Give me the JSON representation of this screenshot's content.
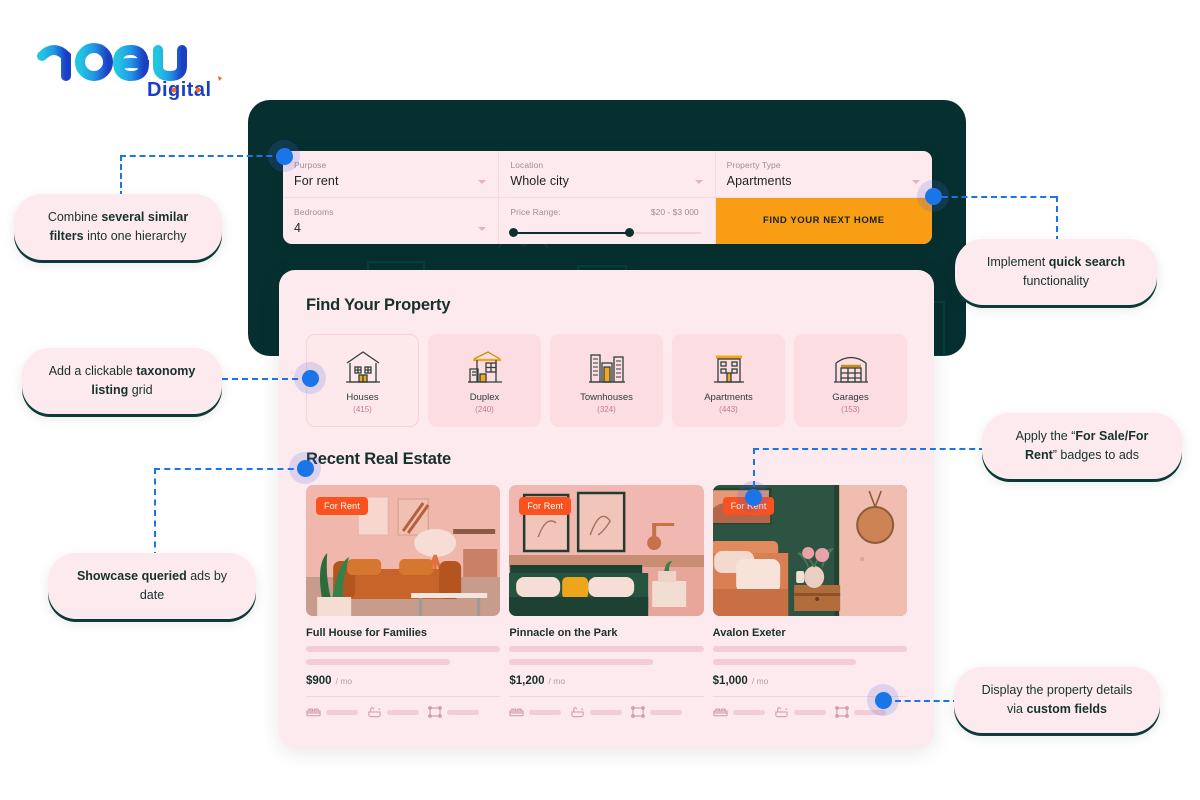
{
  "brand": {
    "name": "naeu",
    "sub": "Digital"
  },
  "filters": [
    {
      "label": "Purpose",
      "value": "For rent",
      "name": "purpose"
    },
    {
      "label": "Location",
      "value": "Whole city",
      "name": "location"
    },
    {
      "label": "Property Type",
      "value": "Apartments",
      "name": "property-type"
    },
    {
      "label": "Bedrooms",
      "value": "4",
      "name": "bedrooms"
    }
  ],
  "price": {
    "label": "Price Range:",
    "value": "$20 - $3 000"
  },
  "cta": {
    "label": "FIND YOUR NEXT HOME"
  },
  "sections": {
    "taxonomy_title": "Find Your Property",
    "recent_title": "Recent Real Estate"
  },
  "taxonomy": [
    {
      "label": "Houses",
      "count": "(415)",
      "icon": "house-icon"
    },
    {
      "label": "Duplex",
      "count": "(240)",
      "icon": "duplex-icon"
    },
    {
      "label": "Townhouses",
      "count": "(324)",
      "icon": "townhouse-icon"
    },
    {
      "label": "Apartments",
      "count": "(443)",
      "icon": "apartment-icon"
    },
    {
      "label": "Garages",
      "count": "(153)",
      "icon": "garage-icon"
    }
  ],
  "listings": [
    {
      "badge": "For Rent",
      "title": "Full House for Families",
      "price": "$900",
      "unit": "/ mo"
    },
    {
      "badge": "For Rent",
      "title": "Pinnacle on the Park",
      "price": "$1,200",
      "unit": "/ mo"
    },
    {
      "badge": "For Rent",
      "title": "Avalon Exeter",
      "price": "$1,000",
      "unit": "/ mo"
    }
  ],
  "callouts": {
    "filters": {
      "pre": "Combine ",
      "bold": "several similar filters",
      "post": " into one hierarchy"
    },
    "search": {
      "pre": "Implement ",
      "bold": "quick search",
      "post": " functionality"
    },
    "taxonomy": {
      "pre": "Add a clickable ",
      "bold": "taxonomy listing",
      "post": " grid"
    },
    "badges": {
      "pre": "Apply the “",
      "bold": "For Sale/For Rent",
      "post": "” badges to ads"
    },
    "showcase": {
      "pre": "",
      "bold": "Showcase queried",
      "post": " ads by date"
    },
    "details": {
      "pre": "Display the property details via ",
      "bold": "custom fields",
      "post": ""
    }
  },
  "colors": {
    "dark_panel": "#06302f",
    "pink_card": "#fdeaee",
    "accent_orange": "#f99d15",
    "badge_orange": "#f9521e",
    "callout_blue": "#1a76e8"
  }
}
